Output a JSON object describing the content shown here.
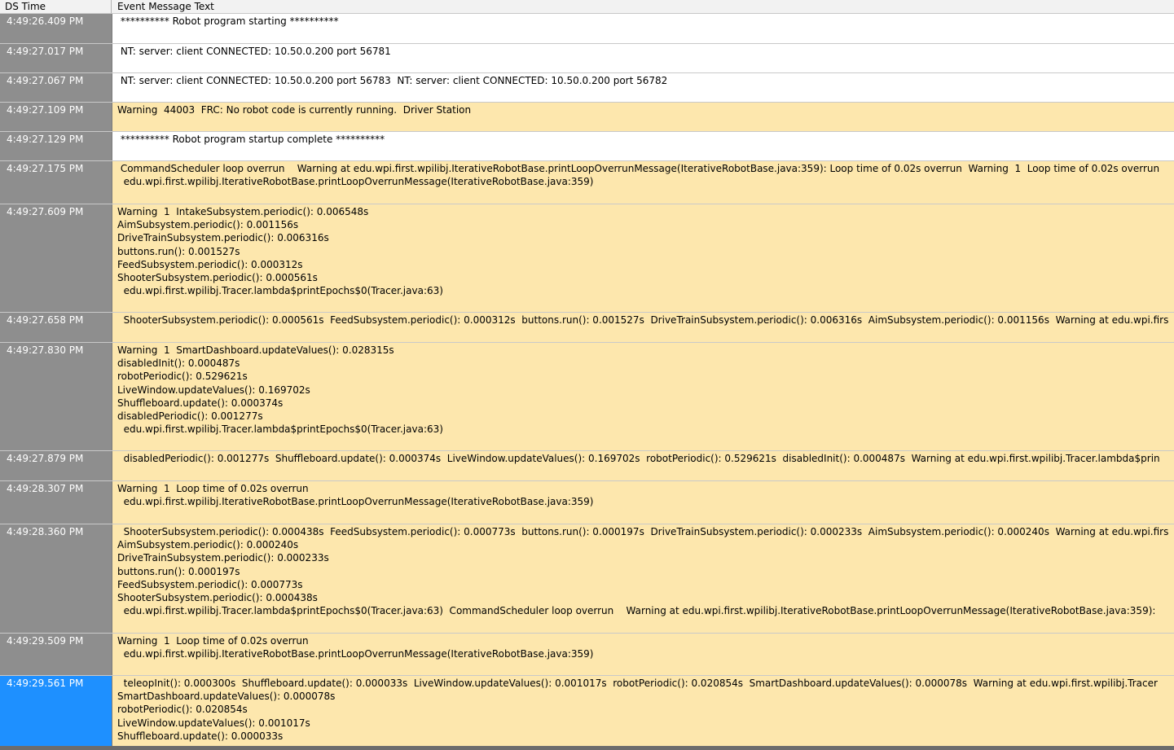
{
  "header": {
    "time_label": "DS Time",
    "message_label": "Event Message Text"
  },
  "rows": [
    {
      "time": "4:49:26.409 PM",
      "type": "info",
      "message": " ********** Robot program starting **********"
    },
    {
      "time": "4:49:27.017 PM",
      "type": "info",
      "message": " NT: server: client CONNECTED: 10.50.0.200 port 56781"
    },
    {
      "time": "4:49:27.067 PM",
      "type": "info",
      "message": " NT: server: client CONNECTED: 10.50.0.200 port 56783  NT: server: client CONNECTED: 10.50.0.200 port 56782"
    },
    {
      "time": "4:49:27.109 PM",
      "type": "warn",
      "message": "Warning  44003  FRC: No robot code is currently running.  Driver Station"
    },
    {
      "time": "4:49:27.129 PM",
      "type": "info",
      "message": " ********** Robot program startup complete **********"
    },
    {
      "time": "4:49:27.175 PM",
      "type": "warn",
      "message": " CommandScheduler loop overrun    Warning at edu.wpi.first.wpilibj.IterativeRobotBase.printLoopOverrunMessage(IterativeRobotBase.java:359): Loop time of 0.02s overrun  Warning  1  Loop time of 0.02s overrun\n  edu.wpi.first.wpilibj.IterativeRobotBase.printLoopOverrunMessage(IterativeRobotBase.java:359)"
    },
    {
      "time": "4:49:27.609 PM",
      "type": "warn",
      "message": "Warning  1  IntakeSubsystem.periodic(): 0.006548s\nAimSubsystem.periodic(): 0.001156s\nDriveTrainSubsystem.periodic(): 0.006316s\nbuttons.run(): 0.001527s\nFeedSubsystem.periodic(): 0.000312s\nShooterSubsystem.periodic(): 0.000561s\n  edu.wpi.first.wpilibj.Tracer.lambda$printEpochs$0(Tracer.java:63)"
    },
    {
      "time": "4:49:27.658 PM",
      "type": "warn",
      "message": "  ShooterSubsystem.periodic(): 0.000561s  FeedSubsystem.periodic(): 0.000312s  buttons.run(): 0.001527s  DriveTrainSubsystem.periodic(): 0.006316s  AimSubsystem.periodic(): 0.001156s  Warning at edu.wpi.firs"
    },
    {
      "time": "4:49:27.830 PM",
      "type": "warn",
      "message": "Warning  1  SmartDashboard.updateValues(): 0.028315s\ndisabledInit(): 0.000487s\nrobotPeriodic(): 0.529621s\nLiveWindow.updateValues(): 0.169702s\nShuffleboard.update(): 0.000374s\ndisabledPeriodic(): 0.001277s\n  edu.wpi.first.wpilibj.Tracer.lambda$printEpochs$0(Tracer.java:63)"
    },
    {
      "time": "4:49:27.879 PM",
      "type": "warn",
      "message": "  disabledPeriodic(): 0.001277s  Shuffleboard.update(): 0.000374s  LiveWindow.updateValues(): 0.169702s  robotPeriodic(): 0.529621s  disabledInit(): 0.000487s  Warning at edu.wpi.first.wpilibj.Tracer.lambda$prin"
    },
    {
      "time": "4:49:28.307 PM",
      "type": "warn",
      "message": "Warning  1  Loop time of 0.02s overrun\n  edu.wpi.first.wpilibj.IterativeRobotBase.printLoopOverrunMessage(IterativeRobotBase.java:359)"
    },
    {
      "time": "4:49:28.360 PM",
      "type": "warn",
      "message": "  ShooterSubsystem.periodic(): 0.000438s  FeedSubsystem.periodic(): 0.000773s  buttons.run(): 0.000197s  DriveTrainSubsystem.periodic(): 0.000233s  AimSubsystem.periodic(): 0.000240s  Warning at edu.wpi.firs\nAimSubsystem.periodic(): 0.000240s\nDriveTrainSubsystem.periodic(): 0.000233s\nbuttons.run(): 0.000197s\nFeedSubsystem.periodic(): 0.000773s\nShooterSubsystem.periodic(): 0.000438s\n  edu.wpi.first.wpilibj.Tracer.lambda$printEpochs$0(Tracer.java:63)  CommandScheduler loop overrun    Warning at edu.wpi.first.wpilibj.IterativeRobotBase.printLoopOverrunMessage(IterativeRobotBase.java:359):"
    },
    {
      "time": "4:49:29.509 PM",
      "type": "warn",
      "message": "Warning  1  Loop time of 0.02s overrun\n  edu.wpi.first.wpilibj.IterativeRobotBase.printLoopOverrunMessage(IterativeRobotBase.java:359)"
    },
    {
      "time": "4:49:29.561 PM",
      "type": "warn",
      "selected": true,
      "message": "  teleopInit(): 0.000300s  Shuffleboard.update(): 0.000033s  LiveWindow.updateValues(): 0.001017s  robotPeriodic(): 0.020854s  SmartDashboard.updateValues(): 0.000078s  Warning at edu.wpi.first.wpilibj.Tracer\nSmartDashboard.updateValues(): 0.000078s\nrobotPeriodic(): 0.020854s\nLiveWindow.updateValues(): 0.001017s\nShuffleboard.update(): 0.000033s"
    }
  ]
}
